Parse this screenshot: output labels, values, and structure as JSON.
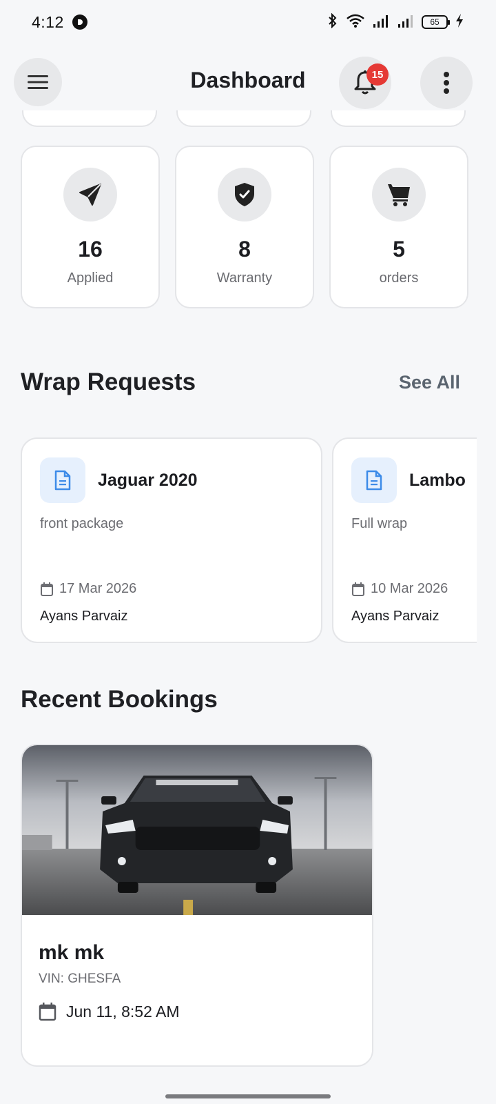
{
  "status_bar": {
    "time": "4:12",
    "battery": "65"
  },
  "header": {
    "title": "Dashboard",
    "notification_count": "15"
  },
  "stats": [
    {
      "value": "16",
      "label": "Applied",
      "icon": "paper-plane-icon"
    },
    {
      "value": "8",
      "label": "Warranty",
      "icon": "shield-check-icon"
    },
    {
      "value": "5",
      "label": "orders",
      "icon": "cart-icon"
    }
  ],
  "wrap_requests": {
    "title": "Wrap Requests",
    "see_all": "See All",
    "items": [
      {
        "title": "Jaguar 2020",
        "description": "front package",
        "date": "17 Mar 2026",
        "person": "Ayans Parvaiz"
      },
      {
        "title": "Lambo",
        "description": "Full wrap",
        "date": "10 Mar 2026",
        "person": "Ayans Parvaiz"
      }
    ]
  },
  "recent_bookings": {
    "title": "Recent Bookings",
    "items": [
      {
        "name": "mk mk",
        "vin": "VIN: GHESFA",
        "date": "Jun 11, 8:52 AM"
      }
    ]
  },
  "colors": {
    "background": "#f6f7f9",
    "badge": "#e53935",
    "doc_icon_bg": "#e6f0fd",
    "doc_icon": "#3d8be8"
  }
}
